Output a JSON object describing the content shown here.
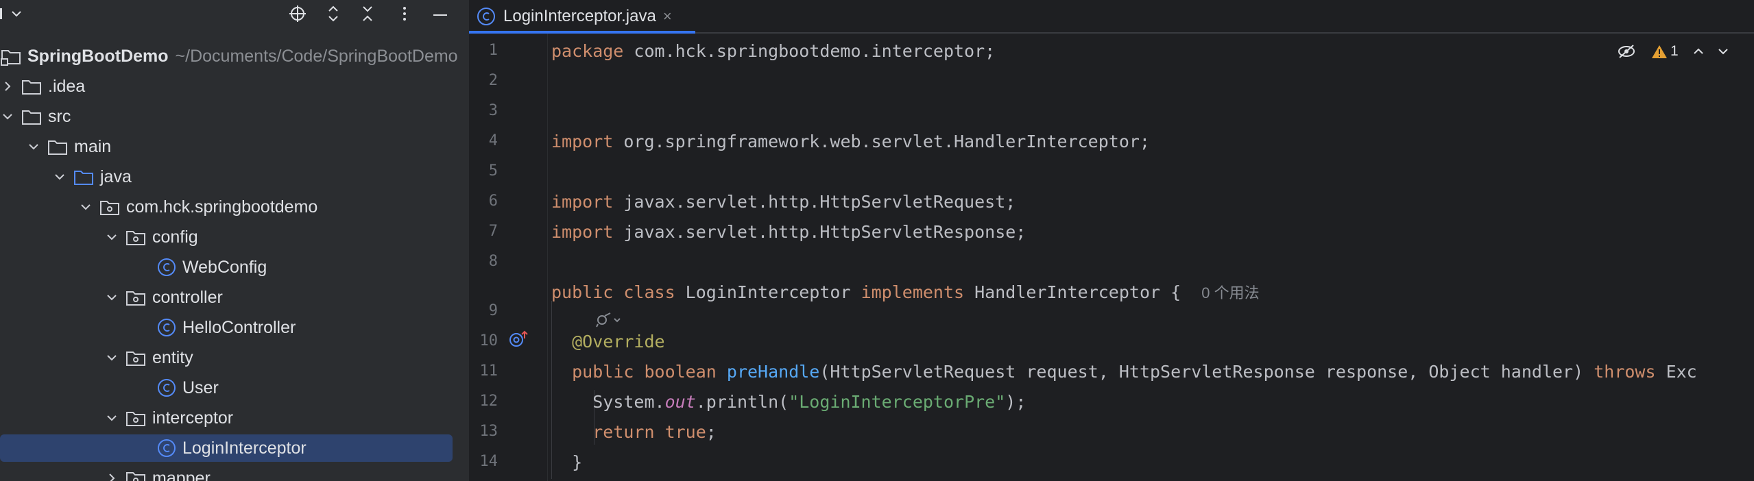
{
  "project_panel": {
    "toolbar": {
      "icons": [
        "panel-menu-icon",
        "chevron-down-icon",
        "locate-icon",
        "expand-all-icon",
        "collapse-all-icon",
        "more-icon",
        "minimize-icon"
      ]
    },
    "root": {
      "name": "SpringBootDemo",
      "path": "~/Documents/Code/SpringBootDemo"
    },
    "tree": [
      {
        "label": ".idea",
        "type": "folder",
        "depth": 0,
        "expanded": false
      },
      {
        "label": "src",
        "type": "folder",
        "depth": 0,
        "expanded": true
      },
      {
        "label": "main",
        "type": "folder",
        "depth": 1,
        "expanded": true
      },
      {
        "label": "java",
        "type": "source-folder",
        "depth": 2,
        "expanded": true
      },
      {
        "label": "com.hck.springbootdemo",
        "type": "package",
        "depth": 3,
        "expanded": true
      },
      {
        "label": "config",
        "type": "package",
        "depth": 4,
        "expanded": true
      },
      {
        "label": "WebConfig",
        "type": "class",
        "depth": 5
      },
      {
        "label": "controller",
        "type": "package",
        "depth": 4,
        "expanded": true
      },
      {
        "label": "HelloController",
        "type": "class",
        "depth": 5
      },
      {
        "label": "entity",
        "type": "package",
        "depth": 4,
        "expanded": true
      },
      {
        "label": "User",
        "type": "class",
        "depth": 5
      },
      {
        "label": "interceptor",
        "type": "package",
        "depth": 4,
        "expanded": true
      },
      {
        "label": "LoginInterceptor",
        "type": "class",
        "depth": 5,
        "selected": true
      },
      {
        "label": "mapper",
        "type": "package",
        "depth": 4,
        "expanded": false
      }
    ]
  },
  "editor": {
    "tab": {
      "label": "LoginInterceptor.java",
      "close": "×"
    },
    "inspections": {
      "warning_count": "1"
    },
    "line_numbers": [
      "1",
      "2",
      "3",
      "4",
      "5",
      "6",
      "7",
      "8",
      "9",
      "10",
      "11",
      "12",
      "13",
      "14"
    ],
    "code": {
      "l1": {
        "kw": "package",
        "rest": " com.hck.springbootdemo.interceptor;"
      },
      "l3": {
        "kw": "import",
        "rest": " org.springframework.web.servlet.HandlerInterceptor;"
      },
      "l5": {
        "kw": "import",
        "rest": " javax.servlet.http.HttpServletRequest;"
      },
      "l6": {
        "kw": "import",
        "rest": " javax.servlet.http.HttpServletResponse;"
      },
      "l8": {
        "kw1": "public class",
        "name": " LoginInterceptor ",
        "kw2": "implements",
        "iface": " HandlerInterceptor {",
        "hint": "0 个用法"
      },
      "l9": {
        "ann": "@Override"
      },
      "l10": {
        "kw": "public boolean",
        "fn": "preHandle",
        "params": "(HttpServletRequest request, HttpServletResponse response, Object handler) ",
        "kw2": "throws",
        "tail": " Exc"
      },
      "l11": {
        "pre": "System.",
        "static": "out",
        "mid": ".println(",
        "str": "\"LoginInterceptorPre\"",
        "post": ");"
      },
      "l12": {
        "kw": "return true",
        "post": ";"
      },
      "l13": {
        "text": "}"
      },
      "l14": {
        "text": "}"
      }
    }
  }
}
